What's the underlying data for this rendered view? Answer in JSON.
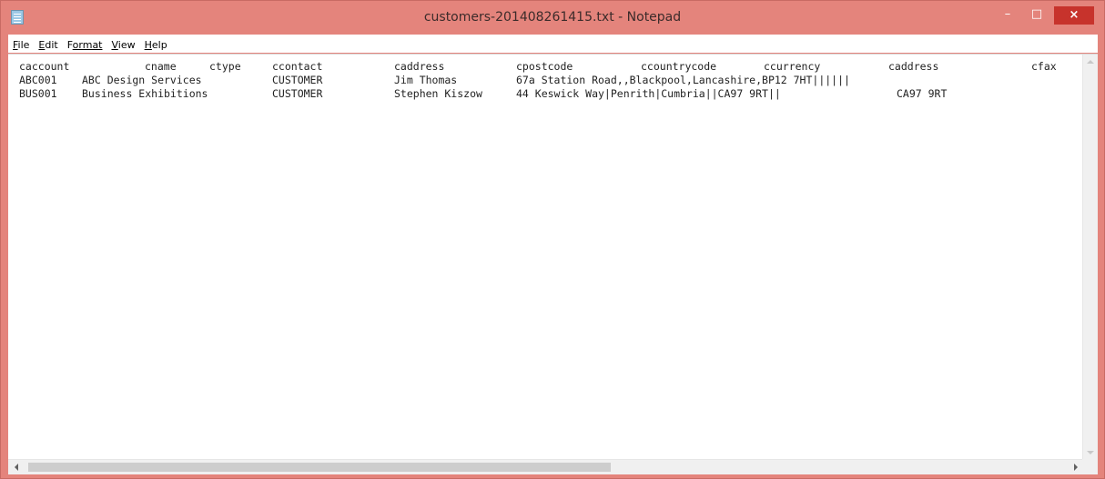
{
  "window": {
    "title": "customers-201408261415.txt - Notepad",
    "controls": {
      "minimize": "–",
      "maximize": "□",
      "close": "×"
    }
  },
  "menu": [
    {
      "label": "File",
      "underline": "F",
      "rest": "ile"
    },
    {
      "label": "Edit",
      "underline": "E",
      "rest": "dit"
    },
    {
      "label": "Format",
      "underline": "F",
      "rest": "ormat"
    },
    {
      "label": "View",
      "underline": "V",
      "rest": "iew"
    },
    {
      "label": "Help",
      "underline": "H",
      "rest": "elp"
    }
  ],
  "document": {
    "header": {
      "caccount": "caccount",
      "cname": "cname",
      "ctype": "ctype",
      "ccontact": "ccontact",
      "caddress": "caddress",
      "cpostcode": "cpostcode",
      "ccountrycode": "ccountrycode",
      "ccurrency": "ccurrency",
      "caddress2": "caddress",
      "cfax": "cfax"
    },
    "rows": [
      {
        "caccount": "ABC001",
        "cname": "ABC Design Services",
        "ctype": "CUSTOMER",
        "ccontact": "Jim Thomas",
        "caddress": "67a Station Road,,Blackpool,Lancashire,BP12 7HT||||||",
        "caddress2": ""
      },
      {
        "caccount": "BUS001",
        "cname": "Business Exhibitions",
        "ctype": "CUSTOMER",
        "ccontact": "Stephen Kiszow",
        "caddress": "44 Keswick Way|Penrith|Cumbria||CA97 9RT||",
        "caddress2": "CA97 9RT"
      }
    ]
  },
  "colors": {
    "titlebar": "#e4847c",
    "close_button": "#c7332c"
  }
}
